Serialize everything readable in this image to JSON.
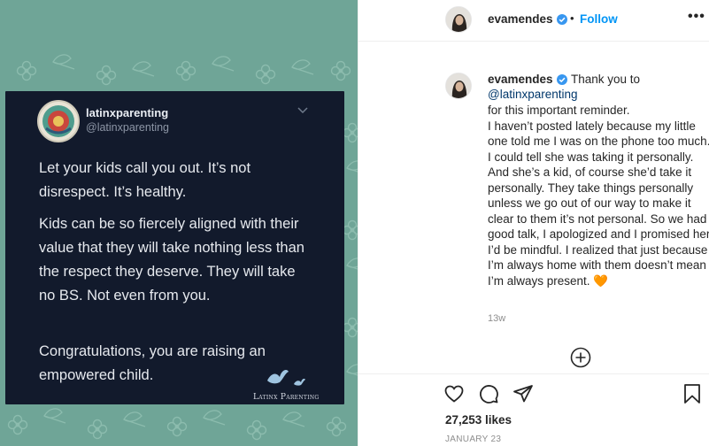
{
  "tweet": {
    "name": "latinxparenting",
    "handle": "@latinxparenting",
    "paragraph1": "Let your kids call you out. It’s not disrespect. It’s healthy.",
    "paragraph2": "Kids can be so fiercely aligned with their value that they will take nothing less than the respect they deserve. They will take no BS. Not even from you.",
    "paragraph3": "Congratulations, you are raising an empowered child.",
    "watermark": "Latinx Parenting",
    "card_color": "#121a2c",
    "background_color": "#6fa597"
  },
  "post": {
    "header_username": "evamendes",
    "separator": "•",
    "follow_label": "Follow",
    "more_label": "•••",
    "caption_username": "evamendes",
    "caption_opening": "Thank you to",
    "caption_mention": "@latinxparenting",
    "caption_body": "for this important reminder.\nI haven’t posted lately because my little one told me I was on the phone too much. I could tell she was taking it personally. And she’s a kid, of course she’d take it personally. They take things personally unless we go out of our way to make it clear to them it’s not personal. So we had good talk, I apologized and I promised her I’d be mindful. I realized that just because I’m always home with them doesn’t mean I’m always present. 🧡",
    "time_ago": "13w",
    "likes": "27,253 likes",
    "date": "JANUARY 23",
    "accent_color": "#0095f6",
    "icons": [
      "heart-icon",
      "comment-icon",
      "share-icon",
      "bookmark-icon",
      "plus-circle-icon",
      "verified-icon"
    ]
  }
}
